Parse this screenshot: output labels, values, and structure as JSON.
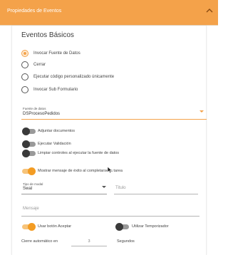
{
  "header": {
    "title": "Propiedades de Eventos"
  },
  "section": {
    "title": "Eventos Básicos"
  },
  "radios": [
    {
      "label": "Invocar Fuente de Datos",
      "selected": true
    },
    {
      "label": "Cerrar",
      "selected": false
    },
    {
      "label": "Ejecutar código personalizado únicamente",
      "selected": false
    },
    {
      "label": "Invocar Sub Formulario",
      "selected": false
    }
  ],
  "datasource": {
    "label": "Fuente de datos",
    "value": "DSProcesoPedidos"
  },
  "toggles_top": [
    {
      "label": "Adjuntar documentos",
      "on": false
    },
    {
      "label": "Ejecutar Validación",
      "on": false
    },
    {
      "label": "Limpiar controles al ejecutar la fuente de datos",
      "on": false
    }
  ],
  "success_message_toggle": {
    "label": "Mostrar mensaje de éxito al completarse la tarea",
    "on": true
  },
  "modal_type": {
    "label": "Tipo de modal",
    "value": "Swal"
  },
  "titulo": {
    "placeholder": "Titulo"
  },
  "mensaje": {
    "placeholder": "Mensaje"
  },
  "accept_button_toggle": {
    "label": "Usar botón Aceptar",
    "on": true
  },
  "timer_toggle": {
    "label": "Utilizar Temporizador",
    "on": false
  },
  "auto_close": {
    "label": "Cierre automático en",
    "value": "3",
    "unit": "Segundos"
  },
  "colors": {
    "accent": "#f4a24a",
    "header_text": "#ffffff"
  }
}
